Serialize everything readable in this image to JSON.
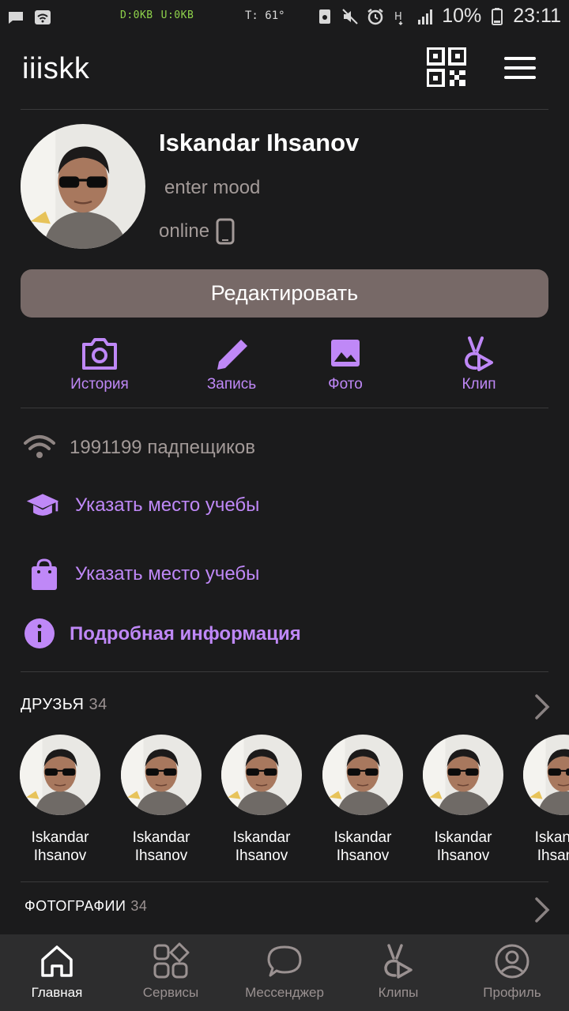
{
  "status_bar": {
    "net_down": "D:0KB",
    "net_up": "U:0KB",
    "temp": "T: 61°",
    "battery": "10%",
    "time": "23:11"
  },
  "header": {
    "title": "iiiskk",
    "qr_icon": "qr-code-icon",
    "menu_icon": "hamburger-menu-icon"
  },
  "profile": {
    "name": "Iskandar Ihsanov",
    "mood": "enter mood",
    "status": "online",
    "edit_label": "Редактировать"
  },
  "actions": [
    {
      "label": "История",
      "icon": "camera-icon"
    },
    {
      "label": "Запись",
      "icon": "pencil-icon"
    },
    {
      "label": "Фото",
      "icon": "image-icon"
    },
    {
      "label": "Клип",
      "icon": "clip-icon"
    }
  ],
  "info": {
    "followers": "1991199 падпещиков",
    "education": "Указать место учебы",
    "work": "Указать место учебы",
    "details": "Подробная информация"
  },
  "friends": {
    "title": "ДРУЗЬЯ",
    "count": "34",
    "items": [
      {
        "first": "Iskandar",
        "last": "Ihsanov"
      },
      {
        "first": "Iskandar",
        "last": "Ihsanov"
      },
      {
        "first": "Iskandar",
        "last": "Ihsanov"
      },
      {
        "first": "Iskandar",
        "last": "Ihsanov"
      },
      {
        "first": "Iskandar",
        "last": "Ihsanov"
      },
      {
        "first": "Iskandar",
        "last": "Ihsanov"
      }
    ]
  },
  "photos": {
    "title": "ФОТОГРАФИИ",
    "count": "34"
  },
  "bottom_nav": [
    {
      "label": "Главная",
      "icon": "home-icon",
      "active": true
    },
    {
      "label": "Сервисы",
      "icon": "services-icon",
      "active": false
    },
    {
      "label": "Мессенджер",
      "icon": "messenger-icon",
      "active": false
    },
    {
      "label": "Клипы",
      "icon": "clips-icon",
      "active": false
    },
    {
      "label": "Профиль",
      "icon": "profile-icon",
      "active": false
    }
  ],
  "colors": {
    "background": "#1b1b1c",
    "accent": "#bf88f7",
    "muted_text": "#a39a98",
    "edit_button": "#776967",
    "nav_background": "#2d2d2e"
  }
}
